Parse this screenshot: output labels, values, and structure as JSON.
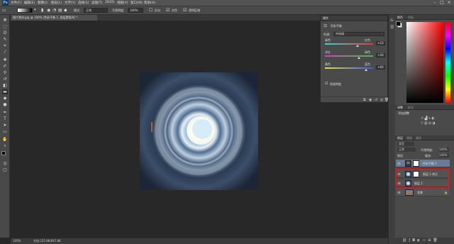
{
  "app": {
    "logo": "Ps"
  },
  "menu": [
    {
      "label": "文件(F)"
    },
    {
      "label": "编辑(E)"
    },
    {
      "label": "图像(I)"
    },
    {
      "label": "图层(L)"
    },
    {
      "label": "文字(Y)"
    },
    {
      "label": "选择(S)"
    },
    {
      "label": "滤镜(T)"
    },
    {
      "label": "3D(D)"
    },
    {
      "label": "视图(V)"
    },
    {
      "label": "窗口(W)"
    },
    {
      "label": "帮助(H)"
    }
  ],
  "options": {
    "preset": "渐变",
    "mode_label": "模式:",
    "mode_value": "正常",
    "opacity_label": "不透明度:",
    "opacity_value": "100%",
    "reverse_label": "反向",
    "dither_label": "仿色",
    "transparency_label": "透明区域"
  },
  "document": {
    "tab_title": "图片素材.jpg @ 100% (色彩平衡 1, 图层蒙版/8) *"
  },
  "statusbar": {
    "zoom": "100%",
    "doc_info": "文档:225.8K/667.8K"
  },
  "properties": {
    "panel_title": "属性",
    "adjustment_name": "色彩平衡",
    "tone_label": "色调:",
    "tone_value": "中间调",
    "sliders": [
      {
        "left": "青色",
        "right": "红色",
        "value": "+23",
        "pct": 0.68,
        "color_left": "#35d6d6",
        "color_right": "#e23c3c"
      },
      {
        "left": "洋红",
        "right": "绿色",
        "value": "+26",
        "pct": 0.7,
        "color_left": "#d640c6",
        "color_right": "#3fc23f"
      },
      {
        "left": "黄色",
        "right": "蓝色",
        "value": "+60",
        "pct": 0.85,
        "color_left": "#e6e13c",
        "color_right": "#3c5be6"
      }
    ],
    "preserve_luminosity": "保留明度"
  },
  "color_panel": {
    "tab_active": "颜色",
    "tab_other": "色板"
  },
  "adjustments_panel": {
    "tab_active": "调整",
    "tab_other": "样式",
    "label": "添加调整"
  },
  "layers_panel": {
    "tabs": [
      "图层",
      "通道",
      "路径"
    ],
    "kind_label": "类型",
    "blend_mode": "正常",
    "opacity_label": "不透明度:",
    "opacity_value": "100%",
    "lock_label": "锁定:",
    "fill_label": "填充:",
    "fill_value": "100%",
    "layers": [
      {
        "name": "色彩平衡 1",
        "kind": "adjustment",
        "selected": true
      },
      {
        "name": "图层 1 拷贝",
        "kind": "smart",
        "selected": false,
        "highlighted": true
      },
      {
        "name": "图层 1",
        "kind": "smart",
        "selected": false,
        "highlighted": true
      },
      {
        "name": "背景",
        "kind": "background",
        "selected": false
      }
    ]
  },
  "colors": {
    "ui_bg": "#282828",
    "panel": "#4a4a4a",
    "selected_layer": "#687c97",
    "highlight_box": "#d01c1c",
    "fg_swatch": "#000000",
    "bg_swatch": "#ffffff"
  }
}
